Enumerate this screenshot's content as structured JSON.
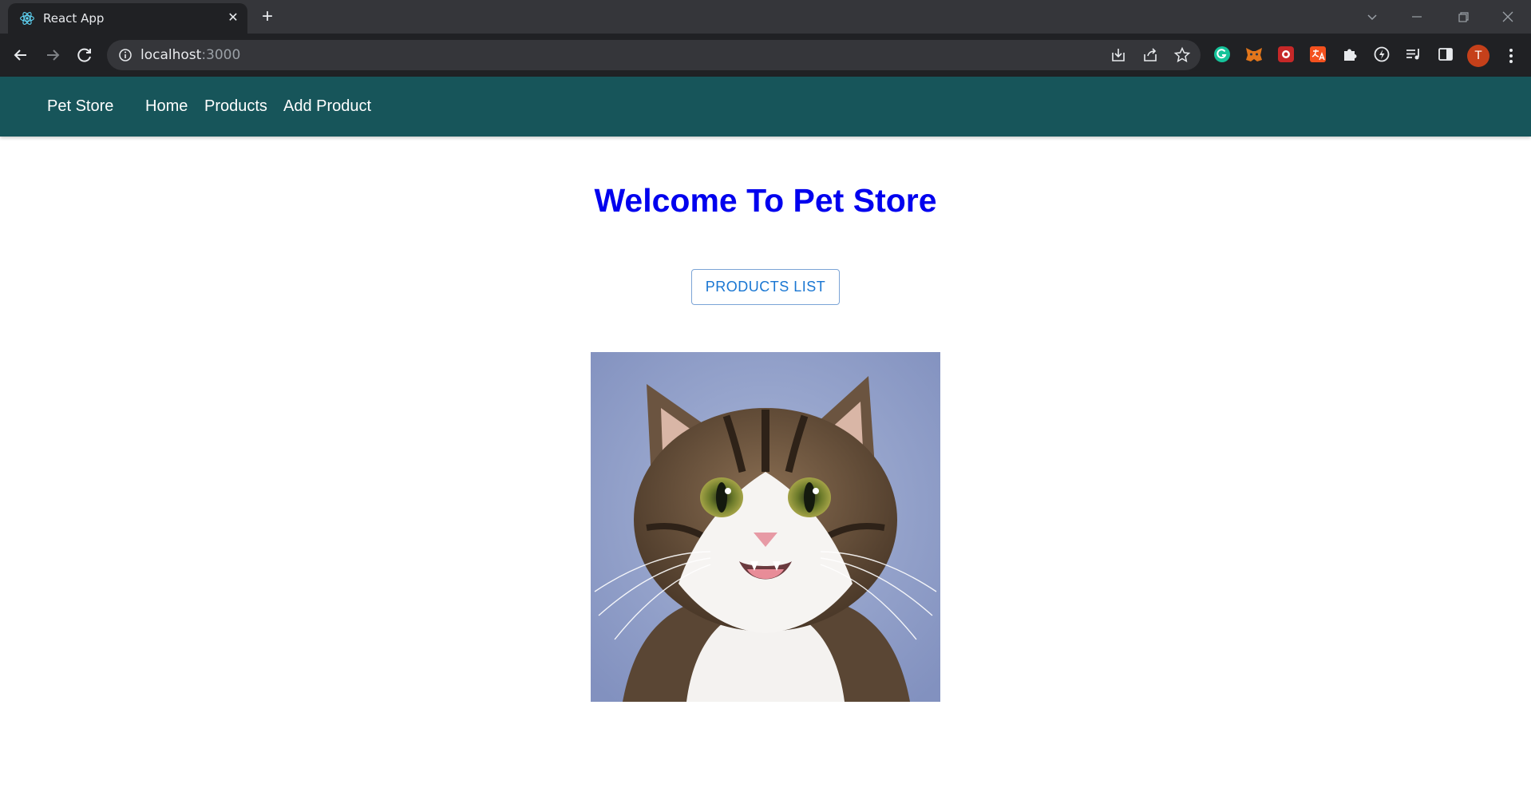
{
  "browser": {
    "tab_title": "React App",
    "url_host": "localhost",
    "url_port": ":3000",
    "profile_initial": "T"
  },
  "nav": {
    "brand": "Pet Store",
    "links": [
      "Home",
      "Products",
      "Add Product"
    ]
  },
  "main": {
    "heading": "Welcome To Pet Store",
    "products_button": "PRODUCTS LIST"
  },
  "colors": {
    "appbar": "#17555a",
    "heading": "#0000ee",
    "button_text": "#1976d2"
  }
}
